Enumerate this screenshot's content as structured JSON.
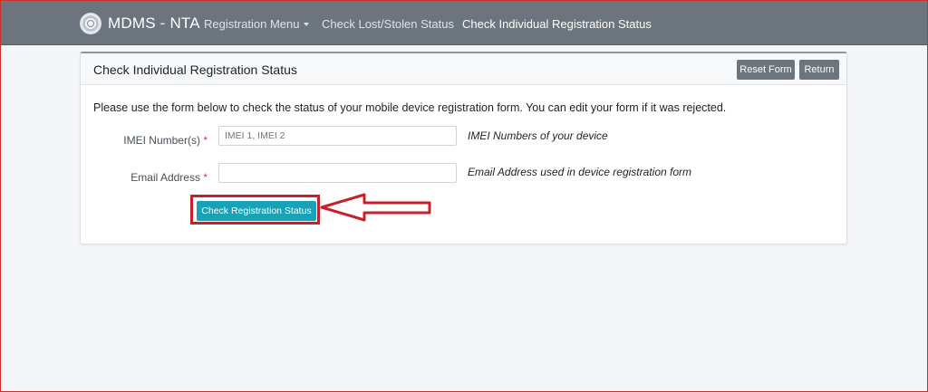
{
  "navbar": {
    "brand": "MDMS - NTA",
    "links": [
      {
        "label": "Registration Menu"
      },
      {
        "label": "Check Lost/Stolen Status"
      },
      {
        "label": "Check Individual Registration Status"
      }
    ]
  },
  "card": {
    "title": "Check Individual Registration Status",
    "reset_label": "Reset Form",
    "return_label": "Return",
    "intro": "Please use the form below to check the status of your mobile device registration form. You can edit your form if it was rejected.",
    "fields": [
      {
        "label": "IMEI Number(s)",
        "required_mark": "*",
        "placeholder": "IMEI 1, IMEI 2",
        "value": "",
        "hint": "IMEI Numbers of your device"
      },
      {
        "label": "Email Address",
        "required_mark": "*",
        "placeholder": "",
        "value": "",
        "hint": "Email Address used in device registration form"
      }
    ],
    "submit_label": "Check Registration Status"
  },
  "colors": {
    "navbar_bg": "#6c757d",
    "primary_action": "#17a2b8",
    "annotation_red": "#c8202a",
    "required_red": "#dc3545"
  },
  "icons": {
    "brand": "seal-icon",
    "dropdown": "caret-down-icon",
    "annotation": "arrow-left-icon"
  }
}
